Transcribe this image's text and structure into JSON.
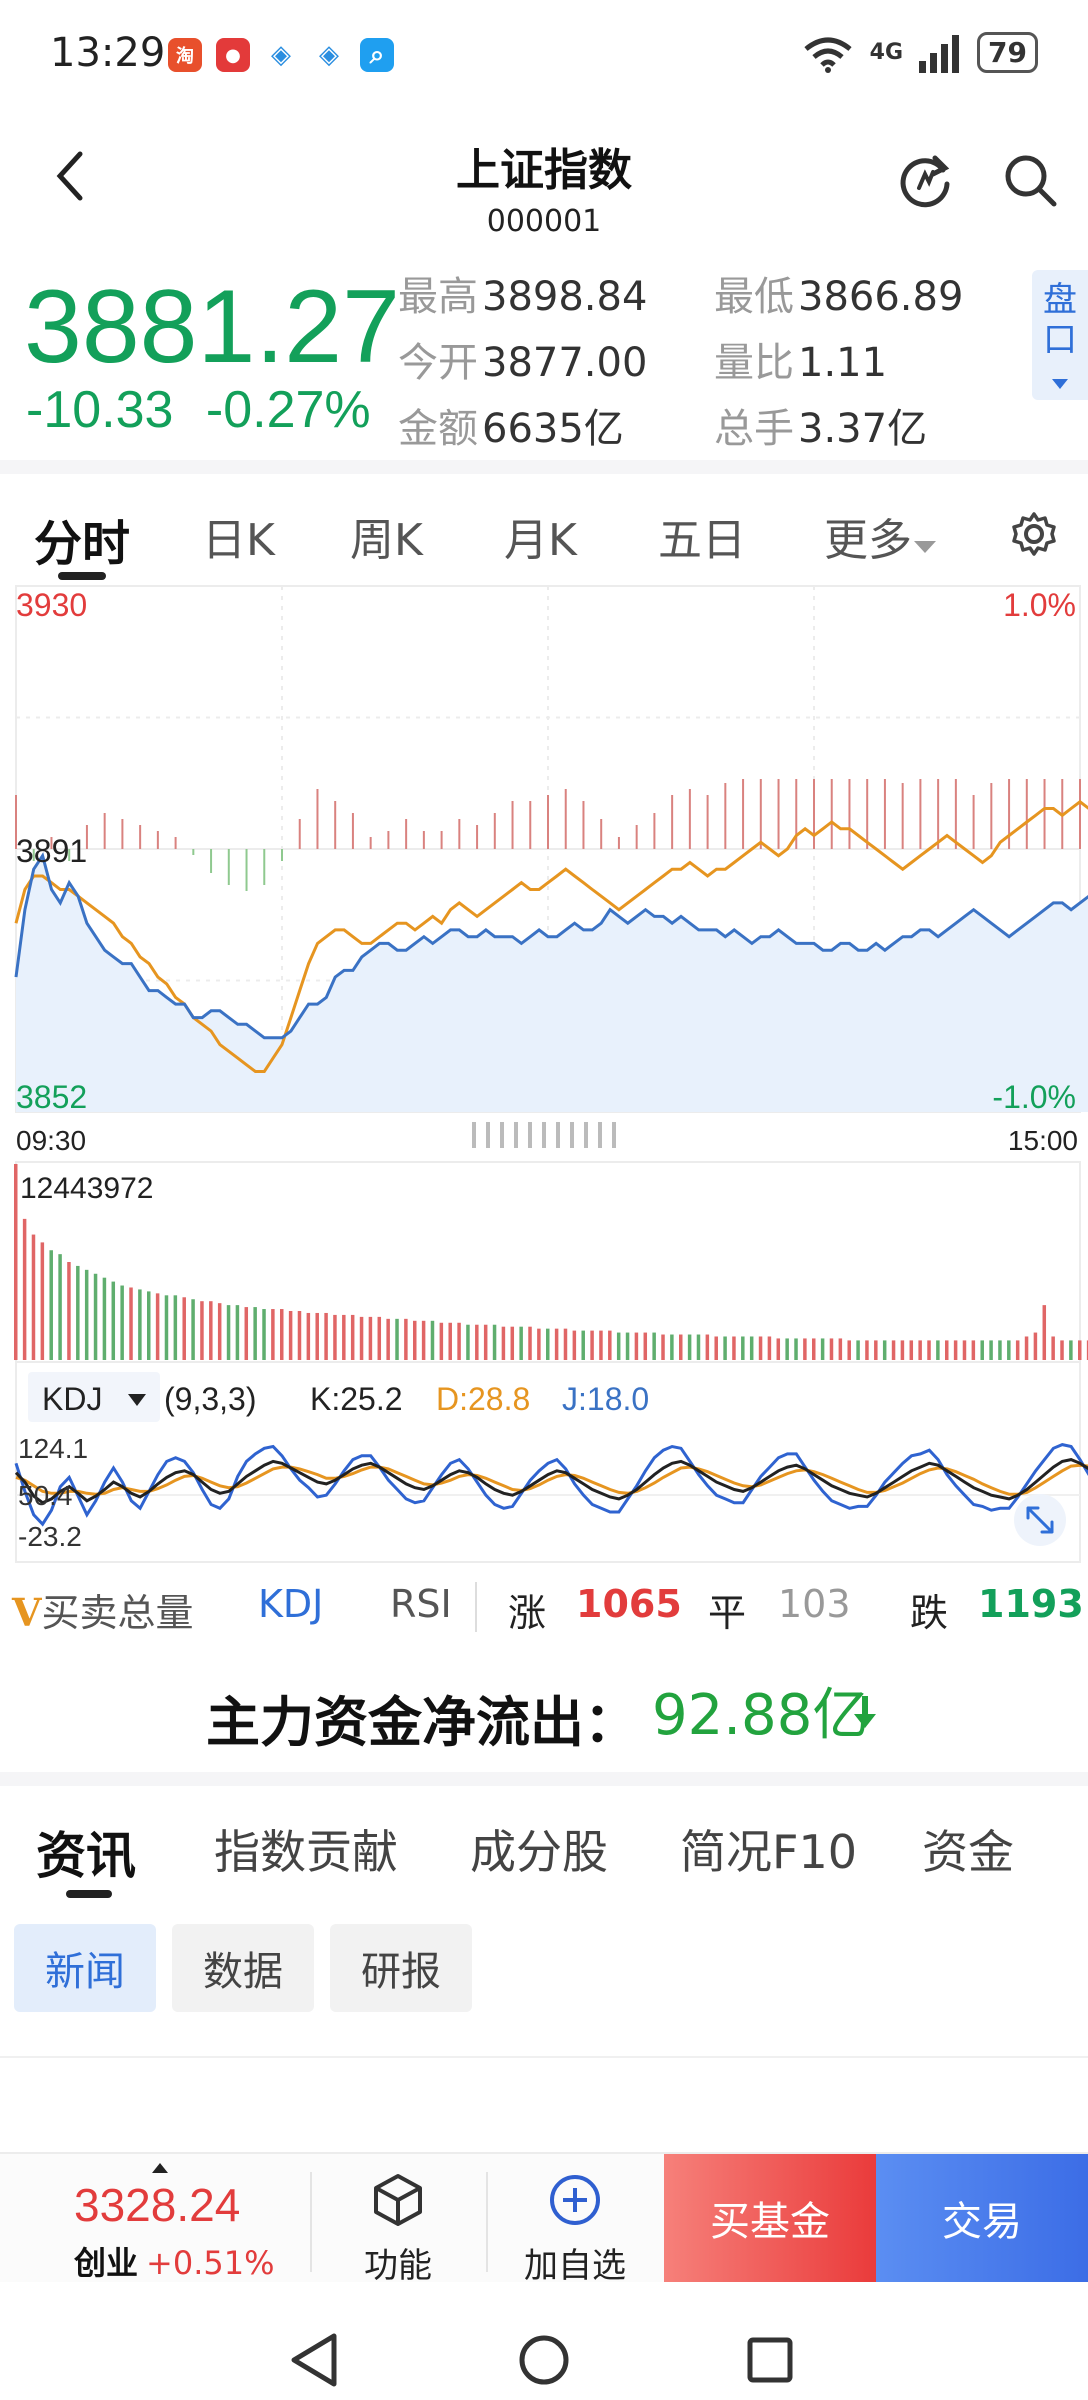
{
  "status_bar": {
    "time": "13:29",
    "battery": "79",
    "network": "4G"
  },
  "header": {
    "title": "上证指数",
    "code": "000001"
  },
  "quote": {
    "price": "3881.27",
    "change": "-10.33",
    "change_pct": "-0.27%",
    "stats": [
      {
        "label": "最高",
        "value": "3898.84"
      },
      {
        "label": "最低",
        "value": "3866.89"
      },
      {
        "label": "今开",
        "value": "3877.00"
      },
      {
        "label": "量比",
        "value": "1.11"
      },
      {
        "label": "金额",
        "value": "6635亿"
      },
      {
        "label": "总手",
        "value": "3.37亿"
      }
    ],
    "pankou_label": "盘口"
  },
  "period_tabs": [
    "分时",
    "日K",
    "周K",
    "月K",
    "五日",
    "更多"
  ],
  "chart_data": {
    "type": "line",
    "price_axis": {
      "top": "3930",
      "mid": "3891",
      "bottom": "3852",
      "top_pct": "1.0%",
      "bottom_pct": "-1.0%"
    },
    "time_axis": {
      "start": "09:30",
      "end": "15:00"
    },
    "ylim": [
      3852,
      3930
    ],
    "series": [],
    "price_line": [
      3872,
      3882,
      3888,
      3890,
      3885,
      3883,
      3886,
      3884,
      3880,
      3878,
      3876,
      3875,
      3874,
      3874,
      3872,
      3870,
      3870,
      3869,
      3868,
      3868,
      3866,
      3866,
      3867,
      3867,
      3866,
      3865,
      3865,
      3864,
      3863,
      3863,
      3863,
      3864,
      3866,
      3868,
      3868,
      3869,
      3872,
      3873,
      3873,
      3875,
      3876,
      3877,
      3877,
      3876,
      3876,
      3877,
      3878,
      3877,
      3878,
      3879,
      3879,
      3878,
      3878,
      3879,
      3878,
      3878,
      3878,
      3877,
      3878,
      3879,
      3878,
      3878,
      3879,
      3880,
      3879,
      3879,
      3880,
      3882,
      3881,
      3880,
      3881,
      3882,
      3881,
      3881,
      3880,
      3881,
      3880,
      3879,
      3879,
      3879,
      3878,
      3879,
      3878,
      3877,
      3878,
      3878,
      3879,
      3878,
      3877,
      3877,
      3877,
      3876,
      3876,
      3877,
      3877,
      3876,
      3876,
      3877,
      3876,
      3877,
      3878,
      3878,
      3879,
      3879,
      3878,
      3879,
      3880,
      3881,
      3882,
      3881,
      3880,
      3879,
      3878,
      3879,
      3880,
      3881,
      3882,
      3883,
      3883,
      3882,
      3883,
      3884,
      3884,
      3883,
      3884,
      3883,
      3882,
      3883,
      3882,
      3882,
      3883
    ],
    "avg_line": [
      3880,
      3885,
      3887,
      3887,
      3886,
      3885,
      3885,
      3884,
      3883,
      3882,
      3881,
      3880,
      3878,
      3877,
      3875,
      3874,
      3872,
      3871,
      3869,
      3868,
      3866,
      3865,
      3864,
      3862,
      3861,
      3860,
      3859,
      3858,
      3858,
      3860,
      3862,
      3866,
      3870,
      3874,
      3877,
      3878,
      3879,
      3879,
      3878,
      3877,
      3877,
      3878,
      3879,
      3880,
      3880,
      3879,
      3880,
      3881,
      3880,
      3882,
      3883,
      3882,
      3881,
      3882,
      3883,
      3884,
      3885,
      3886,
      3885,
      3885,
      3886,
      3887,
      3888,
      3887,
      3886,
      3885,
      3884,
      3883,
      3882,
      3883,
      3884,
      3885,
      3886,
      3887,
      3888,
      3888,
      3889,
      3888,
      3887,
      3888,
      3888,
      3889,
      3890,
      3891,
      3892,
      3891,
      3890,
      3891,
      3893,
      3894,
      3893,
      3894,
      3895,
      3894,
      3894,
      3893,
      3892,
      3891,
      3890,
      3889,
      3888,
      3889,
      3890,
      3891,
      3892,
      3893,
      3892,
      3891,
      3890,
      3889,
      3890,
      3892,
      3893,
      3894,
      3895,
      3896,
      3897,
      3897,
      3896,
      3897,
      3898,
      3897,
      3896,
      3895,
      3894,
      3894,
      3895,
      3896,
      3895,
      3896,
      3897
    ],
    "volume_max_label": "12443972",
    "volume": [
      100,
      72,
      64,
      60,
      56,
      54,
      50,
      48,
      46,
      44,
      42,
      40,
      38,
      37,
      36,
      35,
      34,
      33,
      33,
      32,
      31,
      30,
      30,
      29,
      28,
      28,
      27,
      27,
      26,
      26,
      26,
      25,
      25,
      24,
      24,
      24,
      23,
      23,
      23,
      22,
      22,
      22,
      21,
      21,
      21,
      20,
      20,
      20,
      19,
      19,
      19,
      18,
      18,
      18,
      18,
      17,
      17,
      17,
      17,
      16,
      16,
      16,
      16,
      15,
      15,
      15,
      15,
      15,
      14,
      14,
      14,
      14,
      14,
      13,
      13,
      13,
      13,
      13,
      13,
      12,
      12,
      12,
      12,
      12,
      12,
      12,
      11,
      11,
      11,
      11,
      11,
      11,
      11,
      11,
      10,
      10,
      10,
      10,
      10,
      10,
      10,
      10,
      10,
      10,
      10,
      10,
      10,
      10,
      10,
      10,
      10,
      10,
      10,
      10,
      12,
      14,
      28,
      12,
      10,
      10,
      10,
      10,
      10,
      10,
      10,
      10,
      10,
      12,
      14,
      12,
      11,
      10,
      10,
      10,
      10,
      11,
      12
    ],
    "kdj": {
      "label": "KDJ",
      "params": "(9,3,3)",
      "k_label": "K:25.2",
      "d_label": "D:28.8",
      "j_label": "J:18.0",
      "axis": [
        "124.1",
        "50.4",
        "-23.2"
      ],
      "k": [
        70,
        60,
        45,
        38,
        42,
        50,
        55,
        48,
        40,
        45,
        52,
        60,
        55,
        48,
        44,
        50,
        58,
        65,
        70,
        72,
        68,
        60,
        52,
        48,
        50,
        58,
        66,
        72,
        78,
        82,
        80,
        75,
        70,
        65,
        60,
        58,
        62,
        68,
        74,
        78,
        80,
        76,
        70,
        64,
        58,
        54,
        52,
        56,
        62,
        68,
        72,
        70,
        65,
        58,
        52,
        48,
        46,
        50,
        56,
        62,
        68,
        72,
        70,
        64,
        58,
        52,
        48,
        44,
        42,
        46,
        52,
        60,
        68,
        75,
        80,
        82,
        78,
        72,
        66,
        60,
        56,
        52,
        50,
        54,
        60,
        66,
        72,
        76,
        78,
        74,
        68,
        62,
        56,
        52,
        48,
        46,
        44,
        48,
        54,
        60,
        66,
        72,
        76,
        80,
        78,
        72,
        66,
        60,
        54,
        50,
        46,
        44,
        42,
        46,
        52,
        60,
        68,
        76,
        82,
        84,
        80,
        74,
        68,
        62,
        56,
        50,
        44,
        40,
        36,
        34,
        38
      ],
      "d": [
        65,
        62,
        56,
        50,
        48,
        48,
        50,
        50,
        48,
        47,
        48,
        52,
        54,
        52,
        50,
        50,
        53,
        57,
        62,
        66,
        67,
        64,
        60,
        56,
        54,
        55,
        59,
        64,
        69,
        74,
        76,
        76,
        74,
        71,
        68,
        64,
        64,
        66,
        69,
        73,
        76,
        76,
        74,
        70,
        66,
        62,
        58,
        57,
        59,
        62,
        66,
        68,
        67,
        64,
        60,
        56,
        52,
        51,
        53,
        57,
        62,
        66,
        68,
        67,
        64,
        60,
        56,
        52,
        49,
        48,
        50,
        54,
        59,
        65,
        70,
        75,
        76,
        74,
        71,
        67,
        63,
        59,
        56,
        55,
        57,
        61,
        65,
        69,
        72,
        73,
        71,
        68,
        64,
        60,
        56,
        52,
        49,
        49,
        51,
        55,
        59,
        64,
        69,
        73,
        75,
        74,
        71,
        67,
        63,
        58,
        54,
        50,
        47,
        47,
        49,
        54,
        60,
        66,
        72,
        77,
        78,
        77,
        73,
        69,
        64,
        59,
        54,
        49,
        45,
        41,
        39
      ],
      "j": [
        80,
        50,
        25,
        15,
        30,
        55,
        65,
        45,
        25,
        40,
        60,
        75,
        60,
        40,
        32,
        50,
        68,
        82,
        86,
        82,
        70,
        52,
        36,
        32,
        42,
        66,
        82,
        90,
        96,
        98,
        88,
        74,
        62,
        54,
        44,
        46,
        58,
        72,
        84,
        88,
        88,
        76,
        62,
        52,
        42,
        38,
        40,
        54,
        68,
        80,
        84,
        74,
        60,
        46,
        36,
        32,
        34,
        48,
        62,
        72,
        80,
        84,
        74,
        58,
        46,
        36,
        32,
        28,
        28,
        42,
        56,
        72,
        86,
        94,
        98,
        96,
        82,
        68,
        56,
        46,
        42,
        38,
        38,
        52,
        66,
        76,
        86,
        90,
        90,
        76,
        62,
        50,
        40,
        36,
        32,
        34,
        34,
        46,
        60,
        70,
        80,
        88,
        90,
        94,
        84,
        68,
        56,
        46,
        36,
        34,
        30,
        32,
        32,
        44,
        58,
        72,
        84,
        96,
        100,
        98,
        84,
        68,
        58,
        48,
        40,
        32,
        26,
        22,
        18,
        20,
        36
      ]
    }
  },
  "indicators": {
    "tabs": [
      "买卖总量",
      "KDJ",
      "RSI"
    ],
    "rise_label": "涨",
    "rise_count": "1065",
    "flat_label": "平",
    "flat_count": "103",
    "fall_label": "跌",
    "fall_count": "1193"
  },
  "fund_flow": {
    "label": "主力资金净流出：",
    "value": "92.88亿"
  },
  "news_tabs": [
    "资讯",
    "指数贡献",
    "成分股",
    "简况F10",
    "资金"
  ],
  "sub_tabs": [
    "新闻",
    "数据",
    "研报"
  ],
  "bottom_bar": {
    "price": "3328.24",
    "name": "创业",
    "change_pct": "+0.51%",
    "func_label": "功能",
    "add_label": "加自选",
    "buy_label": "买基金",
    "trade_label": "交易"
  },
  "colors": {
    "green": "#13a05a",
    "red": "#e23c3c",
    "blue": "#2f6fd8",
    "orange": "#e69520",
    "price_line": "#3a72c4",
    "avg_line": "#e69520"
  }
}
